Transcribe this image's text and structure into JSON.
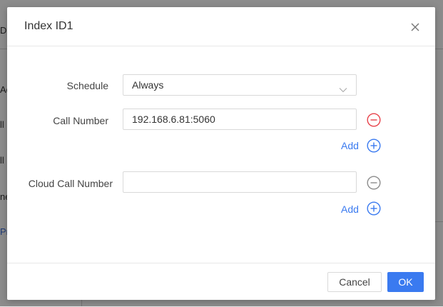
{
  "background": {
    "fragments": [
      "D",
      "Ac",
      "ll",
      "ll",
      "ne",
      "Pr"
    ]
  },
  "dialog": {
    "title": "Index ID1",
    "close_icon": "close-icon",
    "fields": {
      "schedule": {
        "label": "Schedule",
        "value": "Always"
      },
      "call_number": {
        "label": "Call Number",
        "value": "192.168.6.81:5060",
        "remove_color": "#e8424a"
      },
      "cloud_call_number": {
        "label": "Cloud Call Number",
        "value": "",
        "remove_color": "#8c8c8c"
      }
    },
    "add_label": "Add",
    "add_color": "#3a7af0",
    "footer": {
      "cancel_label": "Cancel",
      "ok_label": "OK"
    }
  }
}
